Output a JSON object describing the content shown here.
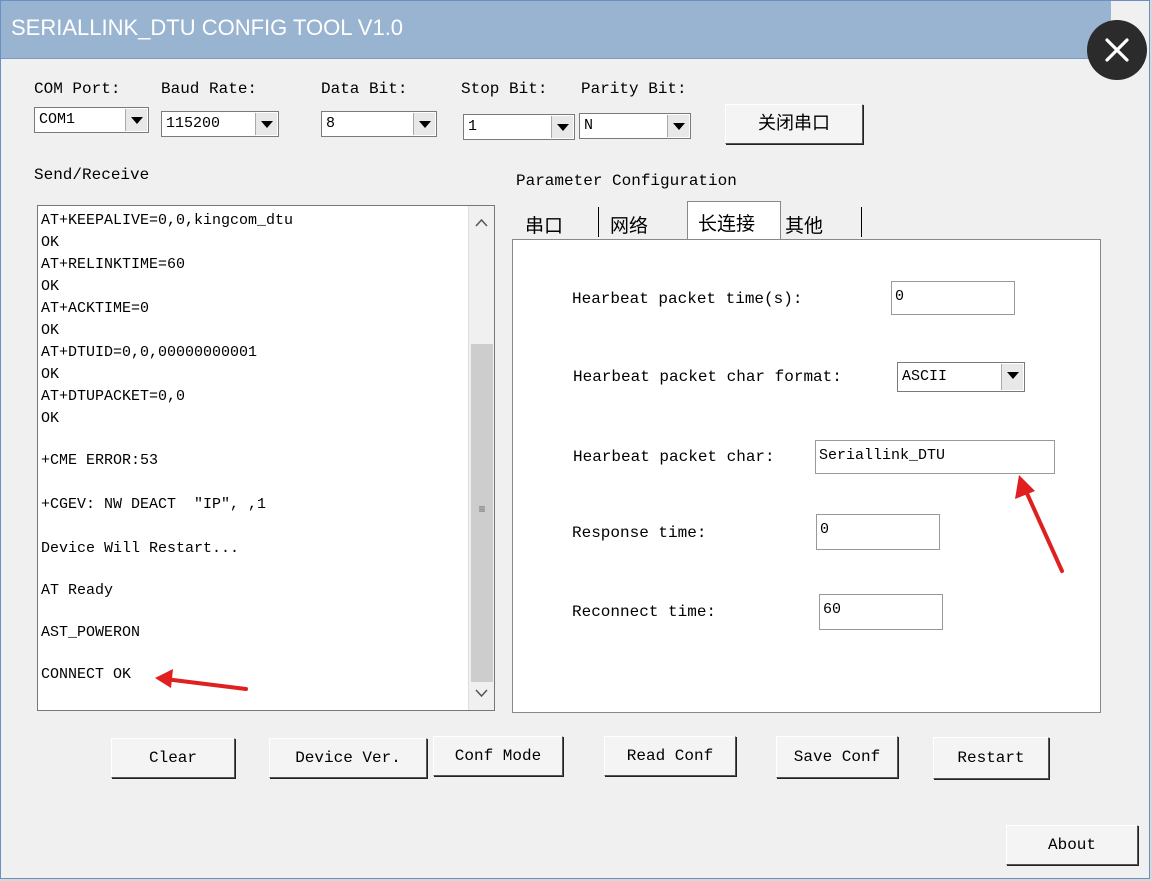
{
  "window": {
    "title": "SERIALLINK_DTU CONFIG TOOL V1.0"
  },
  "serial": {
    "com_port_label": "COM Port:",
    "baud_rate_label": "Baud Rate:",
    "data_bit_label": "Data Bit:",
    "stop_bit_label": "Stop Bit:",
    "parity_bit_label": "Parity Bit:",
    "com_port_value": "COM1",
    "baud_rate_value": "115200",
    "data_bit_value": "8",
    "stop_bit_value": "1",
    "parity_bit_value": "N",
    "close_port_button": "关闭串口"
  },
  "send_receive": {
    "label": "Send/Receive",
    "lines": [
      "AT+KEEPALIVE=0,0,kingcom_dtu",
      "OK",
      "AT+RELINKTIME=60",
      "OK",
      "AT+ACKTIME=0",
      "OK",
      "AT+DTUID=0,0,00000000001",
      "OK",
      "AT+DTUPACKET=0,0",
      "OK",
      "+CME ERROR:53",
      "+CGEV: NW DEACT  \"IP\", ,1",
      "Device Will Restart...",
      "AT Ready",
      "AST_POWERON",
      "CONNECT OK"
    ]
  },
  "param_config": {
    "label": "Parameter Configuration",
    "tabs": [
      "串口",
      "网络",
      "长连接",
      "其他"
    ],
    "active_tab": "长连接",
    "heartbeat_time_label": "Hearbeat packet time(s):",
    "heartbeat_time_value": "0",
    "heartbeat_format_label": "Hearbeat packet char format:",
    "heartbeat_format_value": "ASCII",
    "heartbeat_char_label": "Hearbeat packet char:",
    "heartbeat_char_value": "Seriallink_DTU",
    "response_time_label": "Response time:",
    "response_time_value": "0",
    "reconnect_time_label": "Reconnect time:",
    "reconnect_time_value": "60"
  },
  "buttons": {
    "clear": "Clear",
    "device_ver": "Device Ver.",
    "conf_mode": "Conf Mode",
    "read_conf": "Read Conf",
    "save_conf": "Save Conf",
    "restart": "Restart",
    "about": "About"
  },
  "colors": {
    "titlebar": "#99b4d1",
    "annotation_arrow": "#e02020",
    "window_bg": "#f0f0f0"
  }
}
